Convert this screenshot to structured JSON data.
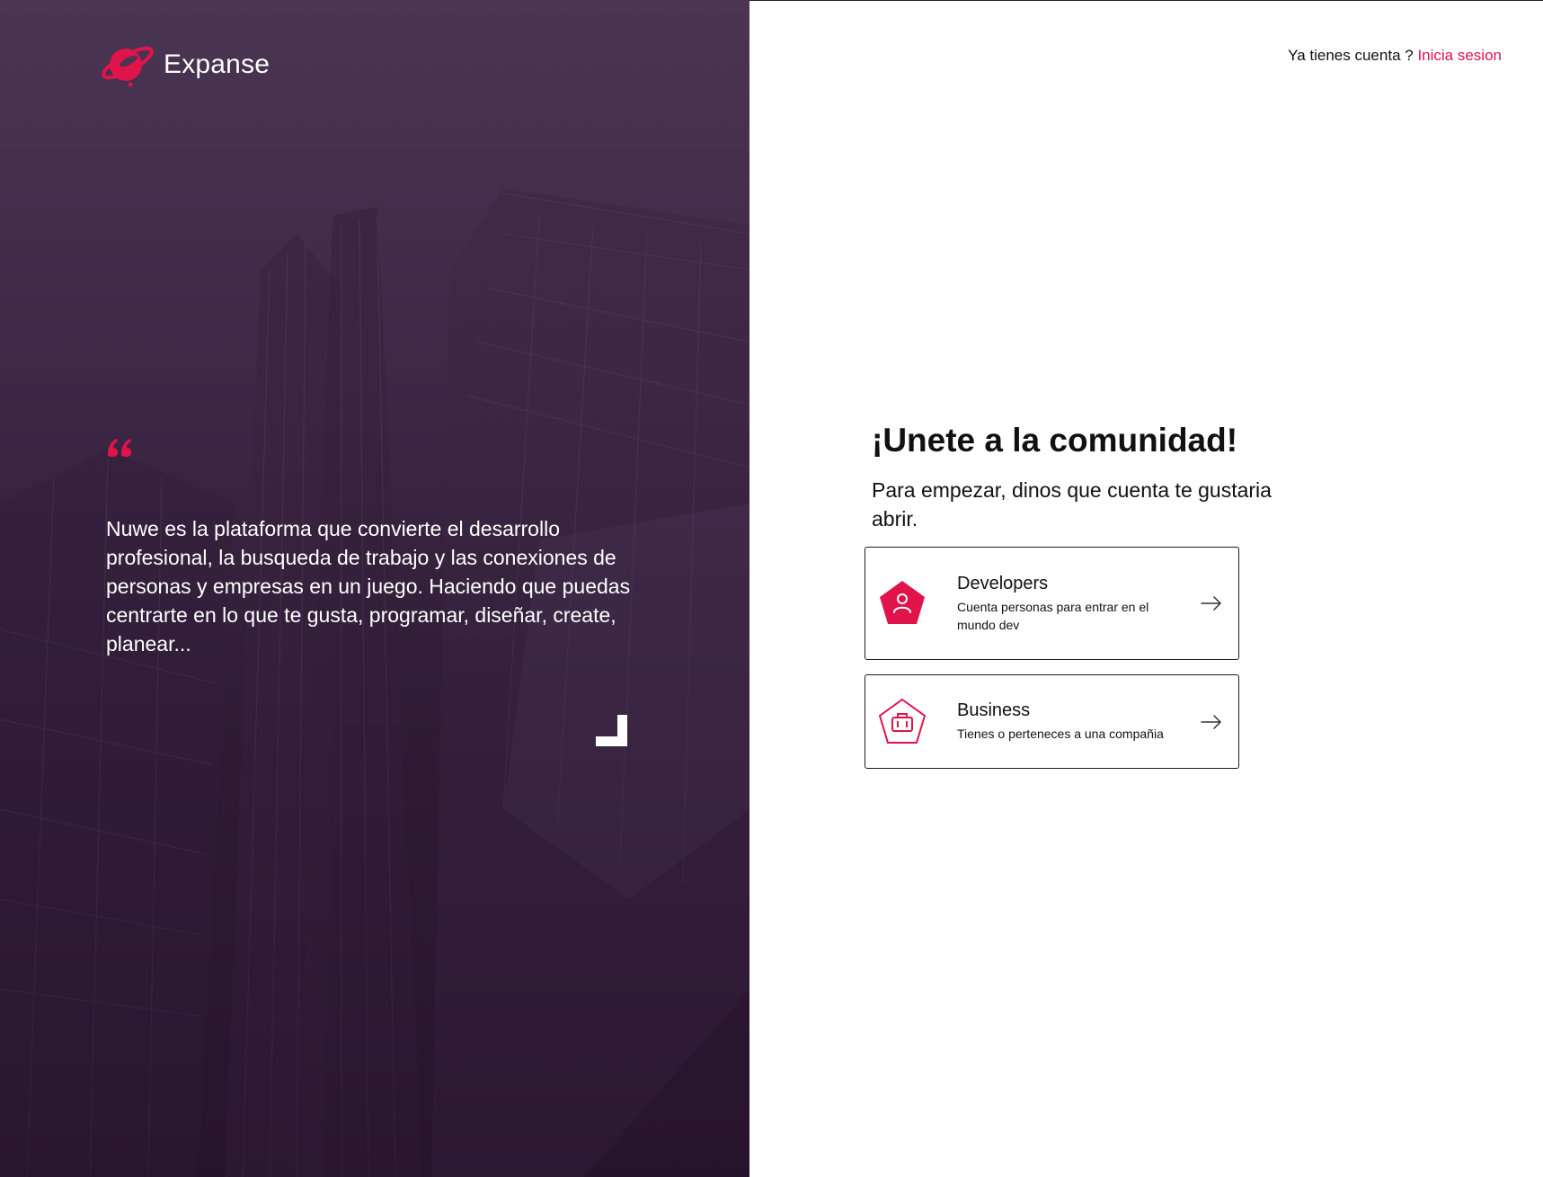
{
  "brand": {
    "name": "Expanse",
    "accent_color": "#e0134a",
    "logo_icon": "planet-logo-icon"
  },
  "hero": {
    "quote_icon": "quote-icon",
    "quote": "Nuwe es la plataforma que convierte el desarrollo profesional, la busqueda de trabajo y las conexiones de personas y empresas en un juego. Haciendo que puedas centrarte en lo que te gusta, programar, diseñar, create, planear...",
    "background": "building-photo-purple-overlay"
  },
  "header": {
    "login_prompt": "Ya tienes cuenta ?",
    "login_link": "Inicia sesion"
  },
  "main": {
    "title": "¡Unete a la comunidad!",
    "subtitle": "Para empezar, dinos que cuenta te gustaria abrir.",
    "options": [
      {
        "title": "Developers",
        "description": "Cuenta personas para entrar en el mundo dev",
        "icon": "user-pentagon-icon"
      },
      {
        "title": "Business",
        "description": "Tienes o perteneces a una compañia",
        "icon": "briefcase-pentagon-icon"
      }
    ]
  }
}
